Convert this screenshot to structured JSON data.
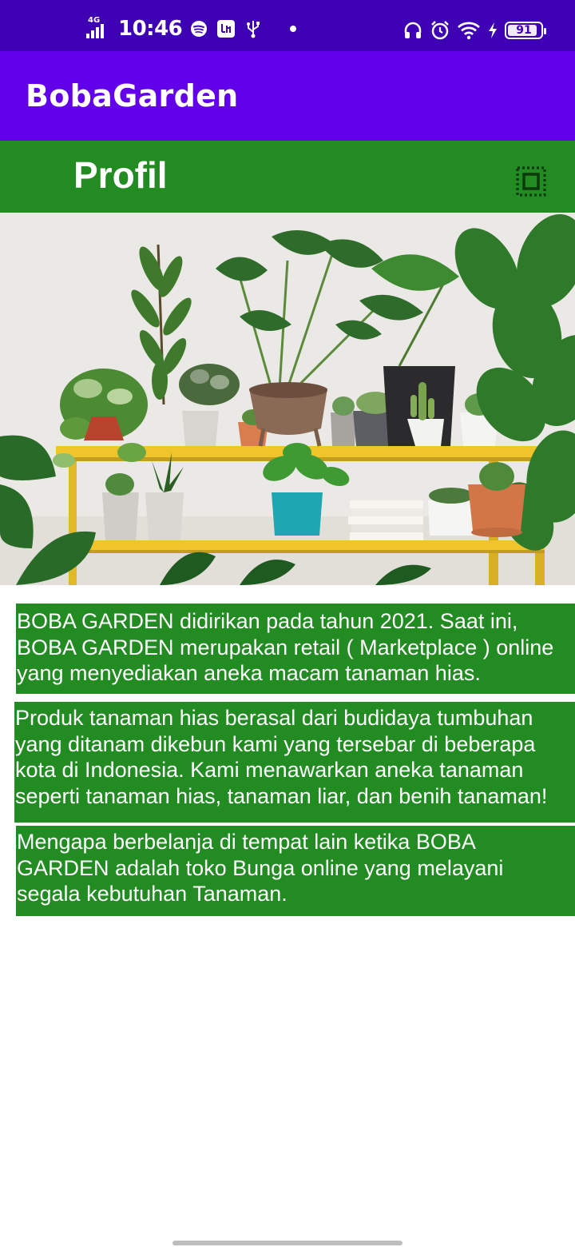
{
  "status_bar": {
    "network": "4G",
    "time": "10:46",
    "battery": "91",
    "battery_level": 0.91,
    "icons_left": [
      "signal-icon",
      "spotify-icon",
      "app-icon",
      "usb-icon",
      "dot-icon"
    ],
    "icons_right": [
      "headphones-icon",
      "alarm-icon",
      "wifi-icon",
      "charging-icon",
      "battery-icon"
    ]
  },
  "app_bar": {
    "title": "BobaGarden"
  },
  "header": {
    "title": "Profil",
    "action_icon": "select-all-icon"
  },
  "hero": {
    "icon": "plants-on-shelf-photo"
  },
  "paragraphs": [
    "BOBA GARDEN didirikan pada tahun 2021. Saat ini,\nBOBA GARDEN merupakan retail ( Marketplace ) online\nyang menyediakan aneka macam tanaman hias.",
    "Produk tanaman hias berasal dari budidaya tumbuhan\nyang ditanam dikebun kami yang tersebar di beberapa\nkota di Indonesia. Kami menawarkan aneka tanaman\nseperti tanaman hias, tanaman liar, dan benih tanaman!",
    "Mengapa berbelanja di tempat lain ketika BOBA\nGARDEN adalah toko Bunga online yang melayani\nsegala kebutuhan Tanaman."
  ],
  "colors": {
    "status_bar": "#3e00b3",
    "app_bar": "#6200ea",
    "accent_green": "#228b22",
    "text": "#ffffff"
  }
}
